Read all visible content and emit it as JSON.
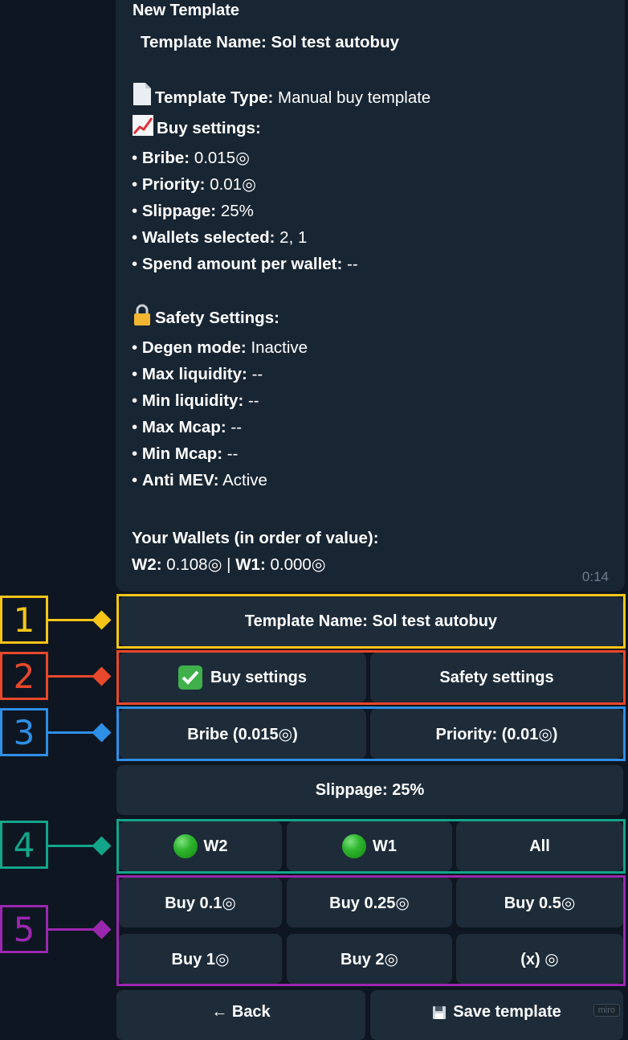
{
  "message": {
    "title": "New Template",
    "template_name_label": "Template Name:",
    "template_name_value": "Sol test autobuy",
    "template_type_label": "Template Type:",
    "template_type_value": "Manual buy template",
    "buy_settings_label": "Buy settings:",
    "buy_settings": [
      {
        "label": "Bribe:",
        "value": "0.015◎"
      },
      {
        "label": "Priority:",
        "value": "0.01◎"
      },
      {
        "label": "Slippage:",
        "value": "25%"
      },
      {
        "label": "Wallets selected:",
        "value": "2, 1"
      },
      {
        "label": "Spend amount per wallet:",
        "value": "--"
      }
    ],
    "safety_settings_label": "Safety Settings:",
    "safety_settings": [
      {
        "label": "Degen mode:",
        "value": "Inactive"
      },
      {
        "label": "Max liquidity:",
        "value": "--"
      },
      {
        "label": "Min liquidity:",
        "value": "--"
      },
      {
        "label": "Max Mcap:",
        "value": "--"
      },
      {
        "label": "Min Mcap:",
        "value": "--"
      },
      {
        "label": "Anti MEV:",
        "value": "Active"
      }
    ],
    "wallets_heading": "Your Wallets (in order of value):",
    "wallets": [
      {
        "label": "W2:",
        "value": "0.108◎"
      },
      {
        "label": "W1:",
        "value": "0.000◎"
      }
    ],
    "wallet_separator": "|",
    "time": "0:14"
  },
  "keyboard": {
    "template_name": "Template Name: Sol test autobuy",
    "buy_settings": "Buy settings",
    "safety_settings": "Safety settings",
    "bribe": "Bribe (0.015◎)",
    "priority": "Priority: (0.01◎)",
    "slippage": "Slippage: 25%",
    "wallet_w2": "W2",
    "wallet_w1": "W1",
    "wallet_all": "All",
    "buy_01": "Buy 0.1◎",
    "buy_025": "Buy 0.25◎",
    "buy_05": "Buy 0.5◎",
    "buy_1": "Buy 1◎",
    "buy_2": "Buy 2◎",
    "buy_x": "(x) ◎",
    "back": "← Back",
    "save": "Save template"
  },
  "annotations": [
    {
      "number": "1",
      "color": "#f5c518"
    },
    {
      "number": "2",
      "color": "#e8482b"
    },
    {
      "number": "3",
      "color": "#2e8fe6"
    },
    {
      "number": "4",
      "color": "#13a589"
    },
    {
      "number": "5",
      "color": "#9b27b0"
    }
  ],
  "watermark": "miro"
}
